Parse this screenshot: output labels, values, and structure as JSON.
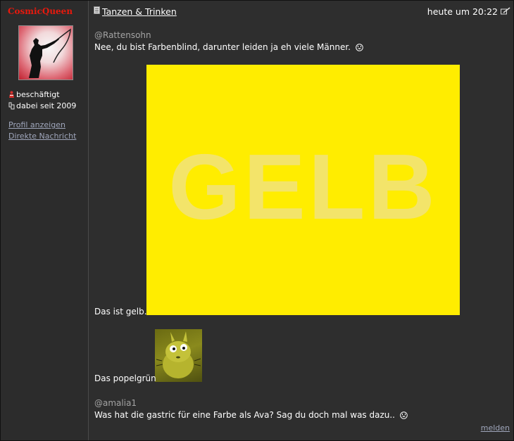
{
  "author": {
    "username": "CosmicQueen",
    "status_busy": "beschäftigt",
    "member_since": "dabei seit 2009",
    "links": {
      "profile": "Profil anzeigen",
      "message": "Direkte Nachricht"
    }
  },
  "post": {
    "topic": "Tanzen & Trinken",
    "timestamp": "heute um 20:22",
    "reply1_mention": "@Rattensohn",
    "reply1_text": "Nee, du bist Farbenblind, darunter leiden ja eh viele Männer.",
    "image_text": "GELB",
    "caption1": "Das ist gelb.",
    "caption2": "Das popelgrün",
    "reply2_mention": "@amalia1",
    "reply2_text": "Was hat die gastric für eine Farbe als Ava? Sag du doch mal was dazu..",
    "report": "melden"
  },
  "colors": {
    "username": "#e8190d",
    "link": "#9fa6bb",
    "mention": "#a4a4a4",
    "yellow": "#ffed00"
  }
}
